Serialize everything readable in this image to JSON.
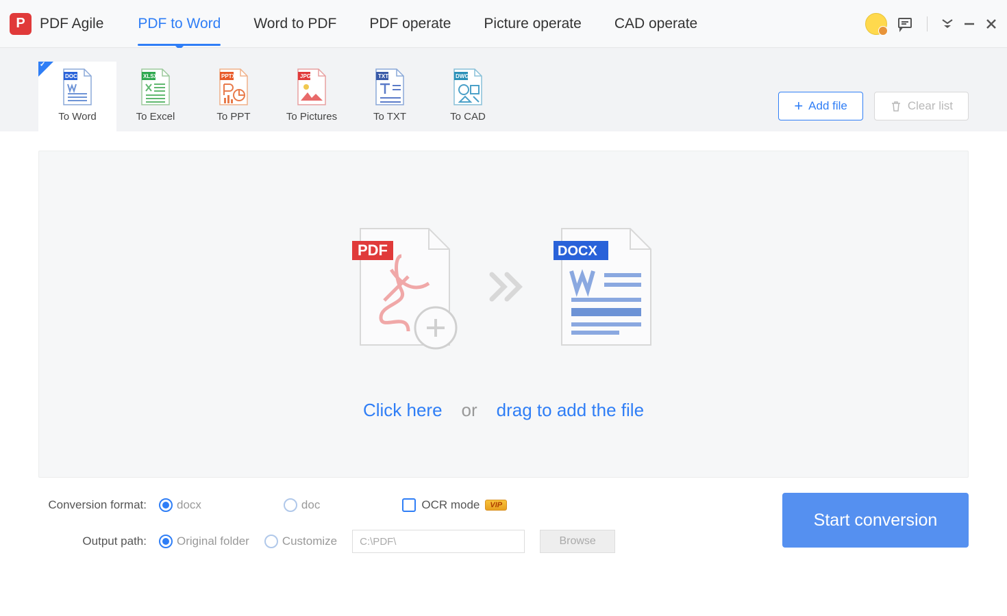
{
  "app": {
    "title": "PDF Agile"
  },
  "mainTabs": {
    "pdf_to_word": "PDF to Word",
    "word_to_pdf": "Word to PDF",
    "pdf_operate": "PDF operate",
    "picture_operate": "Picture operate",
    "cad_operate": "CAD operate"
  },
  "subTools": {
    "to_word": "To Word",
    "to_excel": "To Excel",
    "to_ppt": "To PPT",
    "to_pictures": "To Pictures",
    "to_txt": "To TXT",
    "to_cad": "To CAD"
  },
  "buttons": {
    "add_file": "Add file",
    "clear_list": "Clear list",
    "start": "Start conversion",
    "browse": "Browse"
  },
  "dropzone": {
    "click": "Click here",
    "or": "or",
    "drag": "drag to add the file"
  },
  "options": {
    "format_label": "Conversion format:",
    "docx": "docx",
    "doc": "doc",
    "ocr": "OCR mode",
    "vip": "VIP",
    "output_label": "Output path:",
    "original": "Original folder",
    "customize": "Customize",
    "path_value": "C:\\PDF\\"
  },
  "art": {
    "pdf_badge": "PDF",
    "docx_badge": "DOCX"
  }
}
